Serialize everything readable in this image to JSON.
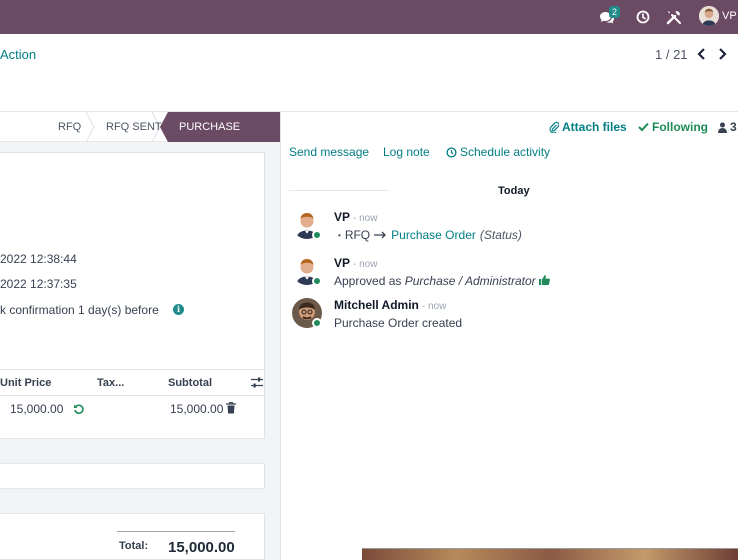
{
  "navbar": {
    "chat_badge": "2",
    "user_initials": "VP"
  },
  "control": {
    "action_label": "Action",
    "pager": "1 / 21"
  },
  "statusbar": {
    "steps": [
      "RFQ",
      "RFQ SENT",
      "PURCHASE ORDER"
    ]
  },
  "form": {
    "date1": "2022 12:38:44",
    "date2": "2022 12:37:35",
    "ask_confirmation": "k confirmation  1  day(s) before"
  },
  "lines": {
    "headers": [
      "Unit Price",
      "Tax...",
      "Subtotal"
    ],
    "rows": [
      {
        "unit_price": "15,000.00",
        "subtotal": "15,000.00"
      }
    ],
    "total_label": "Total:",
    "total_value": "15,000.00"
  },
  "chatter": {
    "attach_label": "Attach files",
    "following_label": "Following",
    "followers_count": "3",
    "send_message": "Send message",
    "log_note": "Log note",
    "schedule_activity": "Schedule activity",
    "today": "Today",
    "messages": [
      {
        "author": "VP",
        "time": "- now",
        "old_value": "RFQ",
        "new_value": "Purchase Order",
        "field": "(Status)"
      },
      {
        "author": "VP",
        "time": "- now",
        "body_prefix": "Approved as ",
        "body_italic": "Purchase / Administrator"
      },
      {
        "author": "Mitchell Admin",
        "time": "- now",
        "body": "Purchase Order created"
      }
    ]
  },
  "colors": {
    "brand": "#6b4a64",
    "link": "#017e84",
    "online": "#1f8b5a"
  }
}
